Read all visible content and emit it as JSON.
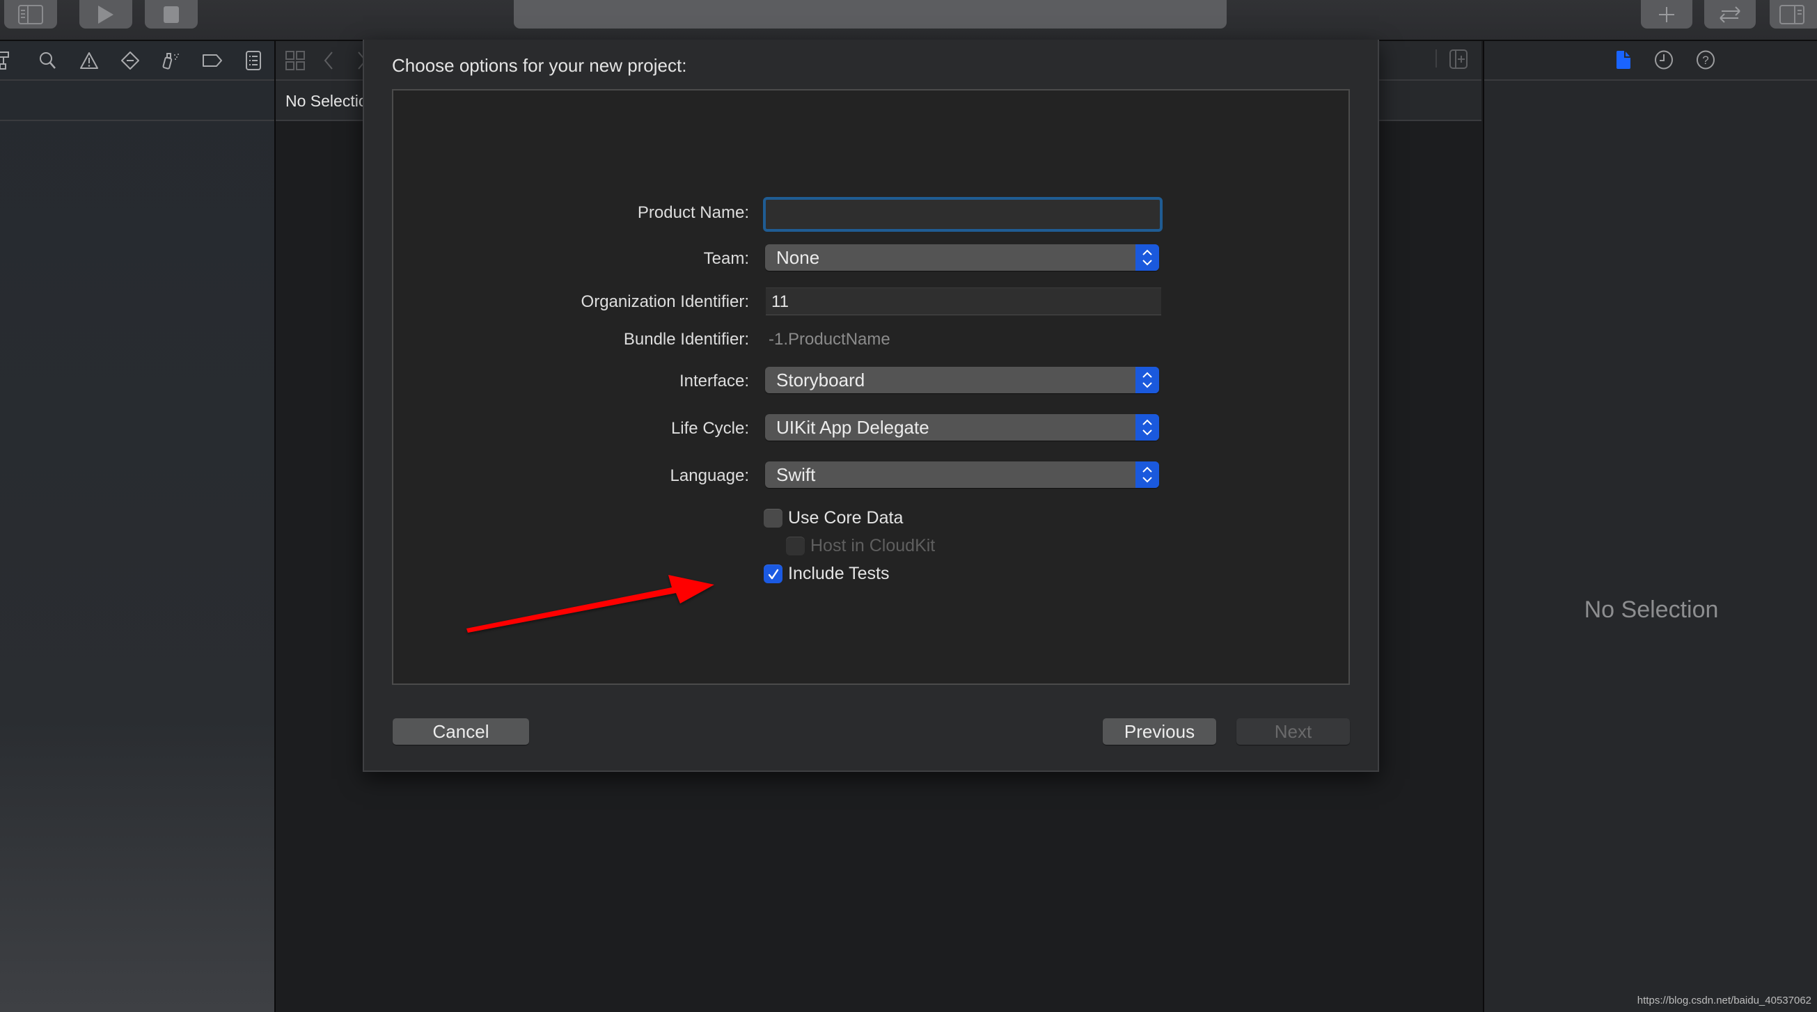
{
  "toolbar": {
    "buttons": [
      {
        "icon": "sidebar-toggle-icon"
      },
      {
        "icon": "run-icon"
      },
      {
        "icon": "stop-icon"
      },
      {
        "icon": "add-library-icon"
      },
      {
        "icon": "code-review-icon"
      },
      {
        "icon": "inspector-toggle-icon"
      }
    ],
    "activity_text": ""
  },
  "navigator": {
    "tabs": [
      {
        "icon": "hierarchy-icon"
      },
      {
        "icon": "search-icon"
      },
      {
        "icon": "warning-icon"
      },
      {
        "icon": "test-diamond-icon"
      },
      {
        "icon": "debug-spray-icon"
      },
      {
        "icon": "breakpoint-tag-icon"
      },
      {
        "icon": "report-list-icon"
      }
    ]
  },
  "editor": {
    "jumpbar_icons": [
      "related-items-grid-icon",
      "back-chevron-icon",
      "forward-chevron-icon",
      "add-editor-icon"
    ],
    "no_selection": "No Selection"
  },
  "inspector": {
    "tabs": [
      {
        "icon": "file-inspector-icon",
        "active": true
      },
      {
        "icon": "history-clock-icon",
        "active": false
      },
      {
        "icon": "quick-help-icon",
        "active": false
      }
    ],
    "no_selection": "No Selection"
  },
  "dialog": {
    "title": "Choose options for your new project:",
    "fields": {
      "product_name": {
        "label": "Product Name:",
        "value": ""
      },
      "team": {
        "label": "Team:",
        "value": "None"
      },
      "organization_identifier": {
        "label": "Organization Identifier:",
        "value": "11"
      },
      "bundle_identifier": {
        "label": "Bundle Identifier:",
        "value": "-1.ProductName"
      },
      "interface": {
        "label": "Interface:",
        "value": "Storyboard"
      },
      "life_cycle": {
        "label": "Life Cycle:",
        "value": "UIKit App Delegate"
      },
      "language": {
        "label": "Language:",
        "value": "Swift"
      }
    },
    "checkboxes": {
      "use_core_data": {
        "label": "Use Core Data",
        "checked": false,
        "enabled": true
      },
      "host_in_cloudkit": {
        "label": "Host in CloudKit",
        "checked": false,
        "enabled": false
      },
      "include_tests": {
        "label": "Include Tests",
        "checked": true,
        "enabled": true
      }
    },
    "buttons": {
      "cancel": "Cancel",
      "previous": "Previous",
      "next": "Next"
    }
  },
  "annotation": {
    "type": "arrow",
    "color": "#ff0000",
    "points_to": "include-tests-checkbox"
  },
  "colors": {
    "accent": "#1b5ae2",
    "focus_ring": "#1f5c93",
    "annotation": "#ff0000"
  },
  "watermark": "https://blog.csdn.net/baidu_40537062"
}
